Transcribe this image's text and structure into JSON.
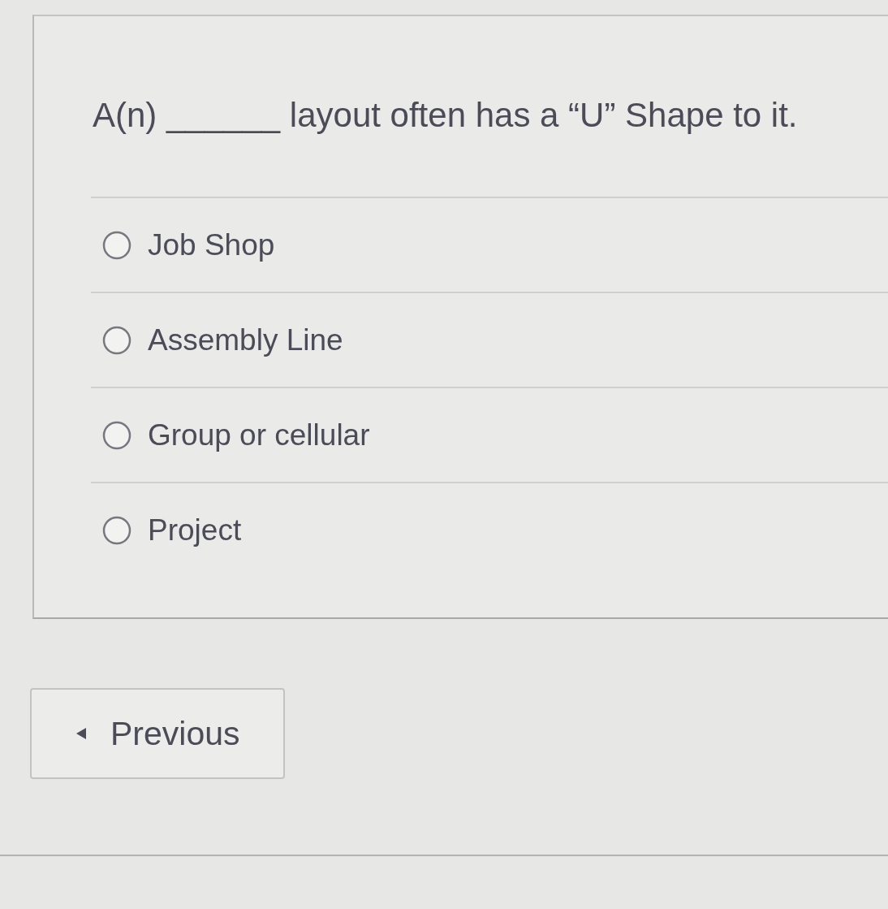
{
  "question": {
    "text": "A(n) ______ layout often has a “U” Shape to it."
  },
  "options": [
    {
      "label": "Job Shop",
      "selected": false
    },
    {
      "label": "Assembly Line",
      "selected": false
    },
    {
      "label": "Group or cellular",
      "selected": false
    },
    {
      "label": "Project",
      "selected": false
    }
  ],
  "navigation": {
    "previous_button": {
      "label": "Previous"
    }
  }
}
